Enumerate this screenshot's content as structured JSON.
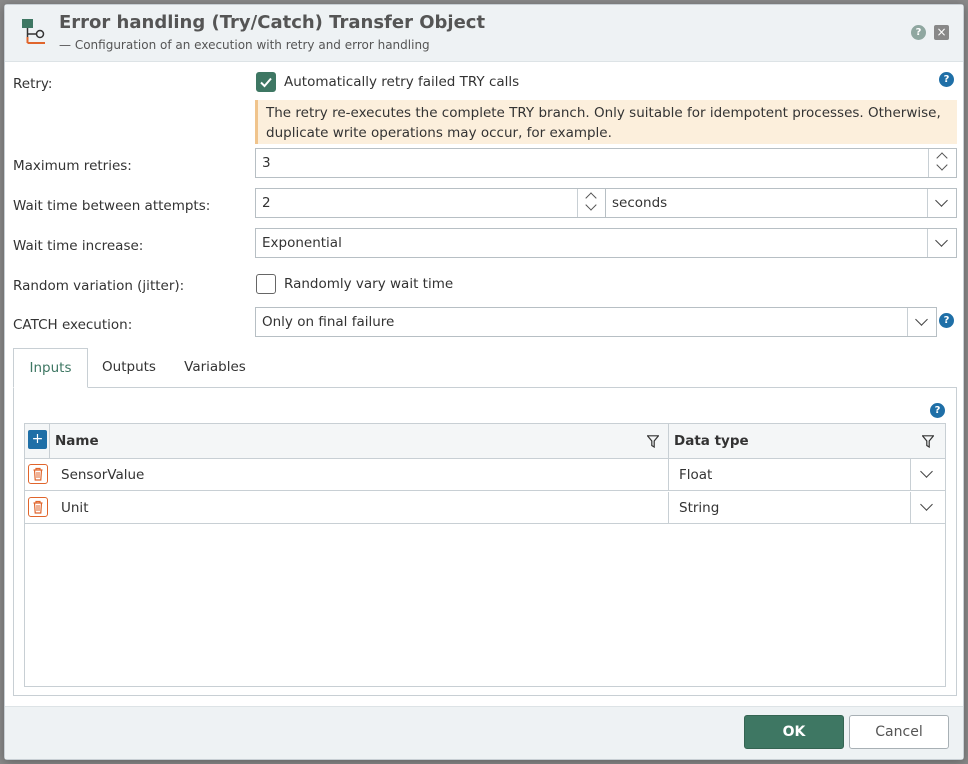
{
  "dialog": {
    "title": "Error handling (Try/Catch) Transfer Object",
    "subtitle": "— Configuration of an execution with retry and error handling",
    "help_glyph": "?",
    "close_glyph": "×"
  },
  "form": {
    "retry": {
      "label": "Retry:",
      "checkbox_label": "Automatically retry failed TRY calls",
      "checked": true,
      "warning": "The retry re-executes the complete TRY branch. Only suitable for idempotent processes. Otherwise, duplicate write operations may occur, for example."
    },
    "max_retries": {
      "label": "Maximum retries:",
      "value": "3"
    },
    "wait_time": {
      "label": "Wait time between attempts:",
      "value": "2",
      "unit": "seconds"
    },
    "wait_increase": {
      "label": "Wait time increase:",
      "value": "Exponential"
    },
    "jitter": {
      "label": "Random variation (jitter):",
      "checkbox_label": "Randomly vary wait time",
      "checked": false
    },
    "catch_execution": {
      "label": "CATCH execution:",
      "value": "Only on final failure"
    }
  },
  "tabs": [
    {
      "label": "Inputs",
      "active": true
    },
    {
      "label": "Outputs",
      "active": false
    },
    {
      "label": "Variables",
      "active": false
    }
  ],
  "grid": {
    "add_glyph": "+",
    "columns": {
      "name": "Name",
      "type": "Data type"
    },
    "rows": [
      {
        "name": "SensorValue",
        "type": "Float"
      },
      {
        "name": "Unit",
        "type": "String"
      }
    ]
  },
  "footer": {
    "ok_label": "OK",
    "cancel_label": "Cancel"
  },
  "colors": {
    "accent": "#3e7763",
    "help": "#1f6fa7",
    "warning_bg": "#fcefdc",
    "delete": "#e0652c"
  }
}
